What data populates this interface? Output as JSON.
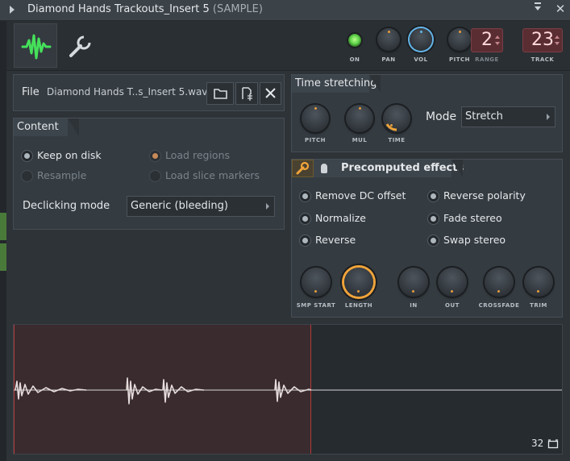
{
  "window": {
    "title": "Diamond Hands Trackouts_Insert 5",
    "subtitle": "(SAMPLE)",
    "close_glyph": "✕"
  },
  "toolbar": {
    "tabs": [
      {
        "icon": "waveform-icon",
        "active": true
      },
      {
        "icon": "wrench-icon",
        "active": false
      }
    ],
    "on_label": "ON",
    "pan_label": "PAN",
    "vol_label": "VOL",
    "pitch_label": "PITCH",
    "range_label": "RANGE",
    "range_value": "2",
    "track_label": "TRACK",
    "track_value": "23"
  },
  "file": {
    "label": "File",
    "name": "Diamond Hands T..s_Insert 5.wav"
  },
  "content": {
    "title": "Content",
    "options": [
      {
        "label": "Keep on disk",
        "selected": true,
        "enabled": true
      },
      {
        "label": "Load regions",
        "selected": true,
        "enabled": false
      },
      {
        "label": "Resample",
        "selected": false,
        "enabled": false
      },
      {
        "label": "Load slice markers",
        "selected": false,
        "enabled": false
      }
    ],
    "declicking_label": "Declicking mode",
    "declicking_value": "Generic (bleeding)"
  },
  "time_stretching": {
    "title": "Time stretching",
    "knobs": [
      "PITCH",
      "MUL",
      "TIME"
    ],
    "mode_label": "Mode",
    "mode_value": "Stretch"
  },
  "precomputed": {
    "title": "Precomputed effects",
    "options": [
      {
        "label": "Remove DC offset",
        "checked": false
      },
      {
        "label": "Reverse polarity",
        "checked": false
      },
      {
        "label": "Normalize",
        "checked": false
      },
      {
        "label": "Fade stereo",
        "checked": false
      },
      {
        "label": "Reverse",
        "checked": false
      },
      {
        "label": "Swap stereo",
        "checked": false
      }
    ],
    "knobs": [
      "SMP START",
      "LENGTH",
      "IN",
      "OUT",
      "CROSSFADE",
      "TRIM"
    ]
  },
  "waveform": {
    "zoom_value": "32",
    "accent_color": "#b23a3a"
  },
  "colors": {
    "accent_orange": "#f0a43a",
    "accent_blue": "#64b6ea",
    "led_green": "#5fd24a"
  }
}
